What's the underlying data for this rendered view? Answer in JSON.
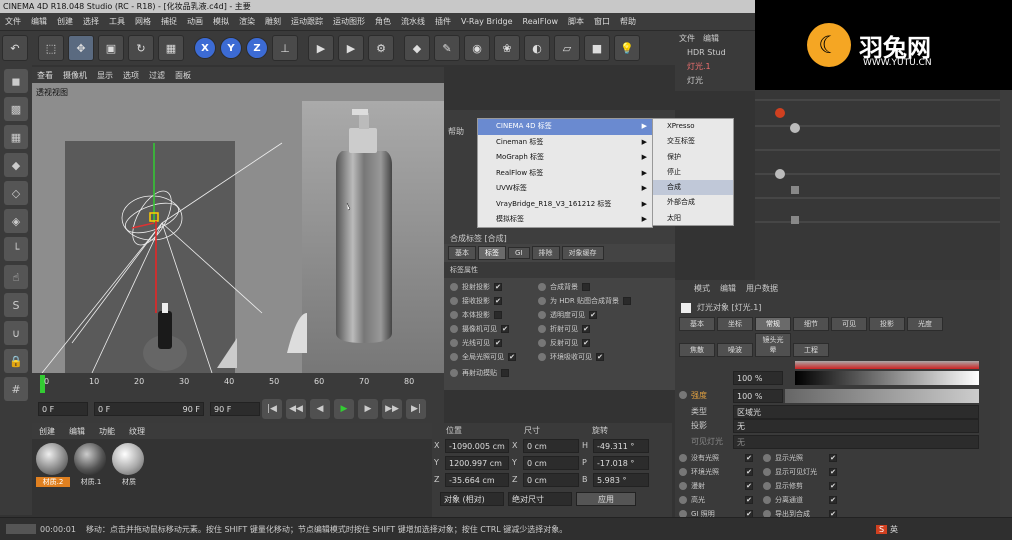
{
  "window": {
    "title": "CINEMA 4D R18.048 Studio (RC - R18) - [化妆品乳液.c4d] - 主要"
  },
  "menubar": [
    "文件",
    "编辑",
    "创建",
    "选择",
    "工具",
    "网格",
    "捕捉",
    "动画",
    "模拟",
    "渲染",
    "雕刻",
    "运动跟踪",
    "运动图形",
    "角色",
    "流水线",
    "插件",
    "V-Ray Bridge",
    "RealFlow",
    "脚本",
    "窗口",
    "帮助"
  ],
  "logo": {
    "cn": "羽兔网",
    "en": "WWW.YUTU.CN"
  },
  "toolbar": {
    "buttons": [
      "undo-icon",
      "live-select-icon",
      "move-icon",
      "scale-icon",
      "rotate-icon",
      "record-icon"
    ],
    "axes": [
      "X",
      "Y",
      "Z"
    ]
  },
  "viewport": {
    "menu": [
      "查看",
      "摄像机",
      "显示",
      "选项",
      "过滤",
      "面板"
    ],
    "label": "透视视图"
  },
  "timeline": {
    "ticks": [
      "0",
      "10",
      "20",
      "30",
      "40",
      "50",
      "60",
      "70",
      "80",
      "90"
    ]
  },
  "transport": {
    "start": "0 F",
    "range_start": "0 F",
    "range_end": "90 F",
    "end": "90 F"
  },
  "materials": {
    "menu": [
      "创建",
      "编辑",
      "功能",
      "纹理"
    ],
    "items": [
      "材质.2",
      "材质.1",
      "材质"
    ]
  },
  "coords": {
    "headers": [
      "位置",
      "尺寸",
      "旋转"
    ],
    "rows": [
      {
        "axis": "X",
        "pos": "-1090.005 cm",
        "size": "0 cm",
        "rot_axis": "H",
        "rot": "-49.311 °"
      },
      {
        "axis": "Y",
        "pos": "1200.997 cm",
        "size": "0 cm",
        "rot_axis": "P",
        "rot": "-17.018 °"
      },
      {
        "axis": "Z",
        "pos": "-35.664 cm",
        "size": "0 cm",
        "rot_axis": "B",
        "rot": "5.983 °"
      }
    ],
    "mode1": "对象 (相对)",
    "mode2": "绝对尺寸",
    "apply": "应用"
  },
  "objects": {
    "menu": [
      "文件",
      "编辑"
    ],
    "items": [
      "HDR Stud",
      "灯光.1",
      "灯光"
    ]
  },
  "context_menu": {
    "items": [
      "CINEMA 4D 标签",
      "Cineman 标签",
      "MoGraph 标签",
      "RealFlow 标签",
      "UVW标签",
      "VrayBridge_R18_V3_161212 标签",
      "模拟标签"
    ],
    "highlighted": 0,
    "help": "帮助"
  },
  "submenu": {
    "items": [
      "XPresso",
      "交互标签",
      "保护",
      "停止",
      "合成",
      "外部合成",
      "太阳"
    ],
    "highlighted": 4
  },
  "compose_tag": {
    "title": "合成标签 [合成]",
    "tabs": [
      "基本",
      "标签",
      "GI",
      "排除",
      "对象缓存"
    ],
    "active_tab": 1,
    "section": "标签属性",
    "left_opts": [
      {
        "label": "投射投影",
        "checked": true
      },
      {
        "label": "接收投影",
        "checked": true
      },
      {
        "label": "本体投影",
        "checked": false
      },
      {
        "label": "摄像机可见",
        "checked": true
      },
      {
        "label": "光线可见",
        "checked": true
      },
      {
        "label": "全局光照可见",
        "checked": true
      }
    ],
    "right_opts": [
      {
        "label": "合成背景",
        "checked": false
      },
      {
        "label": "为 HDR 贴图合成背景",
        "checked": false
      },
      {
        "label": "透明度可见",
        "checked": true
      },
      {
        "label": "折射可见",
        "checked": true
      },
      {
        "label": "反射可见",
        "checked": true
      },
      {
        "label": "环境吸收可见",
        "checked": true
      }
    ],
    "extra": "再射动摸贴"
  },
  "attributes": {
    "menu": [
      "模式",
      "编辑",
      "用户数据"
    ],
    "title": "灯光对象 [灯光.1]",
    "tabs1": [
      "基本",
      "坐标",
      "常规",
      "细节",
      "可见",
      "投影",
      "光度"
    ],
    "tabs2": [
      "焦散",
      "噪波",
      "镜头光晕",
      "工程"
    ],
    "v_label": "V",
    "v_value": "100 %",
    "intensity_label": "强度",
    "intensity_value": "100 %",
    "type_label": "类型",
    "type_value": "区域光",
    "shadow_label": "投影",
    "shadow_value": "无",
    "visible_label": "可见灯光",
    "visible_value": "无",
    "checks_left": [
      "没有光照",
      "环境光照",
      "漫射",
      "高光",
      "GI 照明"
    ],
    "checks_right": [
      "显示光照",
      "显示可见灯光",
      "显示修剪",
      "分离通道",
      "导出到合成"
    ]
  },
  "status": {
    "time": "00:00:01",
    "text": "移动：点击并拖动鼠标移动元素。按住 SHIFT 键量化移动；节点编辑模式时按住 SHIFT 键增加选择对象；按住 CTRL 键减少选择对象。"
  },
  "ime": {
    "label": "英"
  }
}
